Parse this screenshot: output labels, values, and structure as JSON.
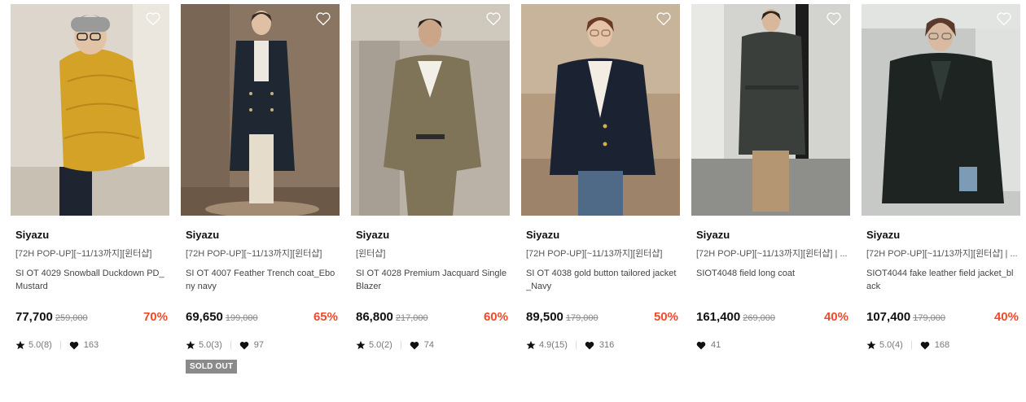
{
  "products": [
    {
      "brand": "Siyazu",
      "tag": "[72H POP-UP][~11/13까지][윈터샵]",
      "title": "SI OT 4029 Snowball Duckdown PD_Mustard",
      "price": "77,700",
      "original_price": "259,000",
      "discount": "70%",
      "rating": "5.0(8)",
      "likes": "163",
      "sold_out": "",
      "colors": {
        "bg": "#d9d3c9",
        "garment": "#d4a227"
      }
    },
    {
      "brand": "Siyazu",
      "tag": "[72H POP-UP][~11/13까지][윈터샵]",
      "title": "SI OT 4007 Feather Trench coat_Ebony navy",
      "price": "69,650",
      "original_price": "199,000",
      "discount": "65%",
      "rating": "5.0(3)",
      "likes": "97",
      "sold_out": "SOLD OUT",
      "colors": {
        "bg": "#8a7562",
        "garment": "#1f2733"
      }
    },
    {
      "brand": "Siyazu",
      "tag": "[윈터샵]",
      "title": "SI OT 4028 Premium Jacquard Single Blazer",
      "price": "86,800",
      "original_price": "217,000",
      "discount": "60%",
      "rating": "5.0(2)",
      "likes": "74",
      "sold_out": "",
      "colors": {
        "bg": "#b9b1a6",
        "garment": "#7f7458"
      }
    },
    {
      "brand": "Siyazu",
      "tag": "[72H POP-UP][~11/13까지][윈터샵]",
      "title": "SI OT 4038 gold button tailored jacket_Navy",
      "price": "89,500",
      "original_price": "179,000",
      "discount": "50%",
      "rating": "4.9(15)",
      "likes": "316",
      "sold_out": "",
      "colors": {
        "bg": "#b49b80",
        "garment": "#1b2232"
      }
    },
    {
      "brand": "Siyazu",
      "tag": "[72H POP-UP][~11/13까지][윈터샵] | ...",
      "title": "SIOT4048 field long coat",
      "price": "161,400",
      "original_price": "269,000",
      "discount": "40%",
      "rating": "",
      "likes": "41",
      "sold_out": "",
      "colors": {
        "bg": "#cfcfcb",
        "garment": "#3a3f3c"
      }
    },
    {
      "brand": "Siyazu",
      "tag": "[72H POP-UP][~11/13까지][윈터샵] | ...",
      "title": "SIOT4044 fake leather field jacket_black",
      "price": "107,400",
      "original_price": "179,000",
      "discount": "40%",
      "rating": "5.0(4)",
      "likes": "168",
      "sold_out": "",
      "colors": {
        "bg": "#c7c9c6",
        "garment": "#1e2421"
      }
    }
  ],
  "icons": {
    "wishlist": "heart-outline-icon",
    "rating": "star-icon",
    "likes": "heart-filled-icon"
  },
  "accent_colors": {
    "discount": "#f04a2a",
    "sold_out_badge": "#8a8a8a"
  }
}
